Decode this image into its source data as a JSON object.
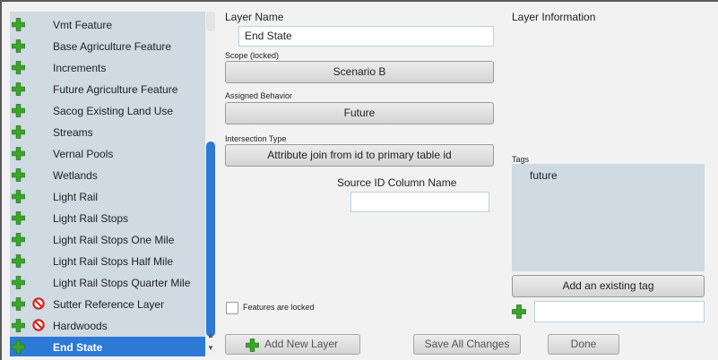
{
  "layers": [
    {
      "label": "Vmt Feature",
      "blocked": false,
      "selected": false
    },
    {
      "label": "Base Agriculture Feature",
      "blocked": false,
      "selected": false
    },
    {
      "label": "Increments",
      "blocked": false,
      "selected": false
    },
    {
      "label": "Future Agriculture Feature",
      "blocked": false,
      "selected": false
    },
    {
      "label": "Sacog Existing Land Use",
      "blocked": false,
      "selected": false
    },
    {
      "label": "Streams",
      "blocked": false,
      "selected": false
    },
    {
      "label": "Vernal Pools",
      "blocked": false,
      "selected": false
    },
    {
      "label": "Wetlands",
      "blocked": false,
      "selected": false
    },
    {
      "label": "Light Rail",
      "blocked": false,
      "selected": false
    },
    {
      "label": "Light Rail Stops",
      "blocked": false,
      "selected": false
    },
    {
      "label": "Light Rail Stops One Mile",
      "blocked": false,
      "selected": false
    },
    {
      "label": "Light Rail Stops Half Mile",
      "blocked": false,
      "selected": false
    },
    {
      "label": "Light Rail Stops Quarter Mile",
      "blocked": false,
      "selected": false
    },
    {
      "label": "Sutter Reference Layer",
      "blocked": true,
      "selected": false
    },
    {
      "label": "Hardwoods",
      "blocked": true,
      "selected": false
    },
    {
      "label": "End State",
      "blocked": false,
      "selected": true
    }
  ],
  "form": {
    "layer_name_label": "Layer Name",
    "layer_name_value": "End State",
    "scope_label": "Scope (locked)",
    "scope_value": "Scenario B",
    "behavior_label": "Assigned Behavior",
    "behavior_value": "Future",
    "intersection_label": "Intersection Type",
    "intersection_value": "Attribute join from id to primary table id",
    "source_id_label": "Source ID Column Name",
    "source_id_value": "",
    "features_locked_label": "Features are locked"
  },
  "info": {
    "title": "Layer Information",
    "tags_label": "Tags",
    "tags": [
      "future"
    ],
    "add_existing_tag_label": "Add an existing tag",
    "new_tag_value": ""
  },
  "actions": {
    "add_new_layer": "Add New Layer",
    "save_all": "Save All Changes",
    "done": "Done"
  },
  "colors": {
    "list_bg": "#cfdae3",
    "selected": "#2c79d6",
    "plus_green": "#3aa62a",
    "ban_red": "#d9261c"
  }
}
